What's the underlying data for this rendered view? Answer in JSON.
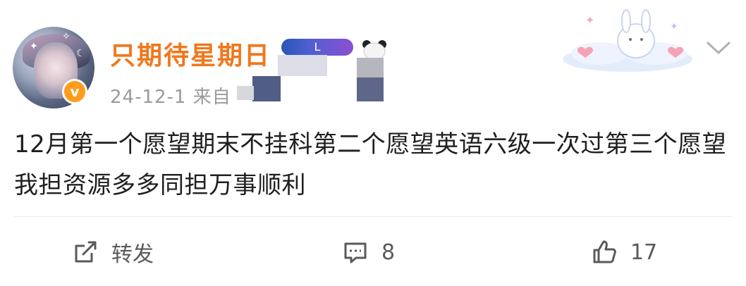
{
  "post": {
    "username": "只期待星期日",
    "badge_text": "L",
    "verified_mark": "v",
    "meta": "24-12-1  来自",
    "content": "12月第一个愿望期末不挂科第二个愿望英语六级一次过第三个愿望我担资源多多同担万事顺利"
  },
  "actions": {
    "repost_label": "转发",
    "comment_count": "8",
    "like_count": "17"
  },
  "icons": {
    "repost": "repost-icon",
    "comment": "comment-icon",
    "like": "thumbs-up-icon",
    "more": "chevron-down-icon"
  },
  "colors": {
    "username": "#f0781d",
    "verified": "#ff9c1b",
    "meta": "#9a9a9a",
    "text": "#1f1f1f"
  }
}
